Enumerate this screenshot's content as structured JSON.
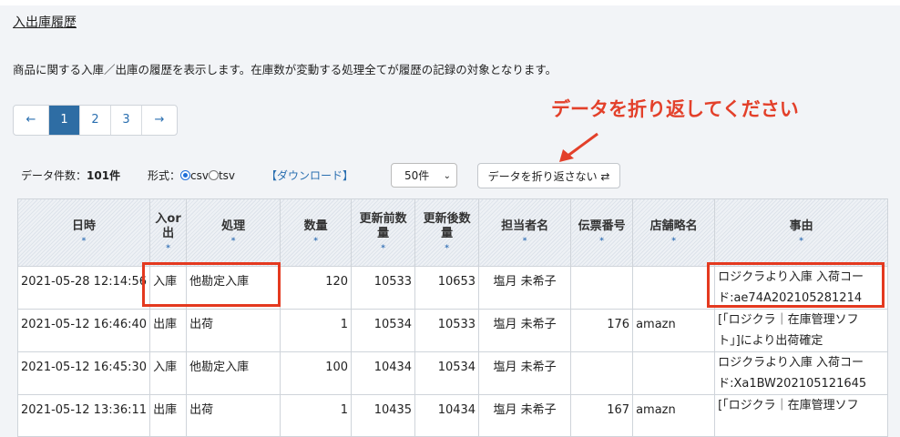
{
  "page": {
    "title": "入出庫履歴",
    "description": "商品に関する入庫／出庫の履歴を表示します。在庫数が変動する処理全てが履歴の記録の対象となります。"
  },
  "pagination": {
    "prev": "←",
    "pages": [
      "1",
      "2",
      "3"
    ],
    "active": "1",
    "next": "→"
  },
  "annotation": "データを折り返してください",
  "controls": {
    "count_label": "データ件数：",
    "count_value": "101件",
    "format_label": "形式：",
    "format_csv": "csv",
    "format_tsv": "tsv",
    "selected_format": "csv",
    "download_link": "【ダウンロード】",
    "per_page": "50件",
    "wrap_button": "データを折り返さない ⇄"
  },
  "table": {
    "headers": {
      "datetime": "日時",
      "inout": "入or出",
      "process": "処理",
      "qty": "数量",
      "before": "更新前数量",
      "after": "更新後数量",
      "person": "担当者名",
      "slip": "伝票番号",
      "store": "店舗略名",
      "reason": "事由",
      "sort_mark": "*"
    },
    "rows": [
      {
        "datetime": "2021-05-28 12:14:56",
        "inout": "入庫",
        "process": "他勘定入庫",
        "qty": "120",
        "before": "10533",
        "after": "10653",
        "person": "塩月 未希子",
        "slip": "",
        "store": "",
        "reason_1": "ロジクラより入庫 入荷コー",
        "reason_2": "ド:ae74A202105281214"
      },
      {
        "datetime": "2021-05-12 16:46:40",
        "inout": "出庫",
        "process": "出荷",
        "qty": "1",
        "before": "10534",
        "after": "10533",
        "person": "塩月 未希子",
        "slip": "176",
        "store": "amazn",
        "reason_1": "[「ロジクラ｜在庫管理ソフ",
        "reason_2": "ト」]により出荷確定"
      },
      {
        "datetime": "2021-05-12 16:45:30",
        "inout": "入庫",
        "process": "他勘定入庫",
        "qty": "100",
        "before": "10434",
        "after": "10534",
        "person": "塩月 未希子",
        "slip": "",
        "store": "",
        "reason_1": "ロジクラより入庫 入荷コー",
        "reason_2": "ド:Xa1BW202105121645"
      },
      {
        "datetime": "2021-05-12 13:36:11",
        "inout": "出庫",
        "process": "出荷",
        "qty": "1",
        "before": "10435",
        "after": "10434",
        "person": "塩月 未希子",
        "slip": "167",
        "store": "amazn",
        "reason_1": "[「ロジクラ｜在庫管理ソフ",
        "reason_2": ""
      }
    ]
  },
  "colors": {
    "accent": "#2e6da4",
    "annotation": "#e3402a",
    "link": "#2a6fb0"
  }
}
